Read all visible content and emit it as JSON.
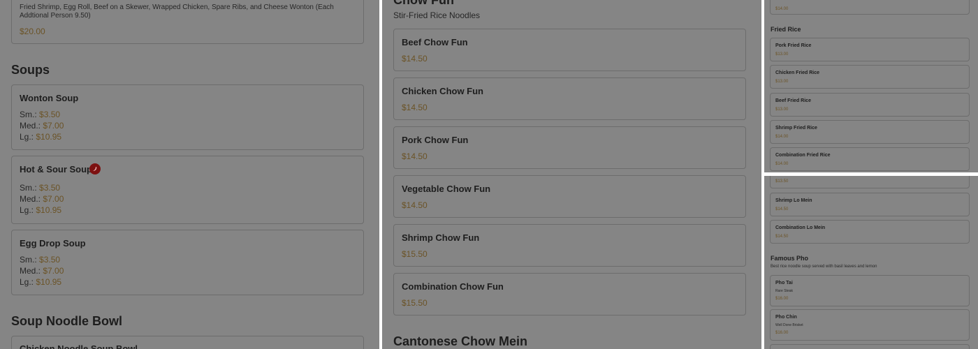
{
  "panel1": {
    "combo_desc": "Fried Shrimp, Egg Roll, Beef on a Skewer, Wrapped Chicken, Spare Ribs, and Cheese Wonton (Each Addtional Person 9.50)",
    "combo_price": "$20.00",
    "soups_title": "Soups",
    "soups": [
      {
        "name": "Wonton Soup",
        "sizes": [
          {
            "label": "Sm.:",
            "price": "$3.50"
          },
          {
            "label": "Med.:",
            "price": "$7.00"
          },
          {
            "label": "Lg.:",
            "price": "$10.95"
          }
        ]
      },
      {
        "name": "Hot & Sour Soup",
        "spicy": true,
        "sizes": [
          {
            "label": "Sm.:",
            "price": "$3.50"
          },
          {
            "label": "Med.:",
            "price": "$7.00"
          },
          {
            "label": "Lg.:",
            "price": "$10.95"
          }
        ]
      },
      {
        "name": "Egg Drop Soup",
        "sizes": [
          {
            "label": "Sm.:",
            "price": "$3.50"
          },
          {
            "label": "Med.:",
            "price": "$7.00"
          },
          {
            "label": "Lg.:",
            "price": "$10.95"
          }
        ]
      }
    ],
    "noodle_title": "Soup Noodle Bowl",
    "noodle_first": "Chicken Noodle Soup Bowl"
  },
  "panel2": {
    "section_title": "Chow Fun",
    "section_sub": "Stir-Fried Rice Noodles",
    "items": [
      {
        "name": "Beef Chow Fun",
        "price": "$14.50"
      },
      {
        "name": "Chicken Chow Fun",
        "price": "$14.50"
      },
      {
        "name": "Pork Chow Fun",
        "price": "$14.50"
      },
      {
        "name": "Vegetable Chow Fun",
        "price": "$14.50"
      },
      {
        "name": "Shrimp Chow Fun",
        "price": "$15.50"
      },
      {
        "name": "Combination Chow Fun",
        "price": "$15.50"
      }
    ],
    "next_section": "Cantonese Chow Mein"
  },
  "panel3": {
    "top_price": "$14.00",
    "section_title": "Fried Rice",
    "items": [
      {
        "name": "Pork Fried Rice",
        "price": "$13.00"
      },
      {
        "name": "Chicken Fried Rice",
        "price": "$13.00"
      },
      {
        "name": "Beef Fried Rice",
        "price": "$13.00"
      },
      {
        "name": "Shrimp Fried Rice",
        "price": "$14.00"
      },
      {
        "name": "Combination Fried Rice",
        "price": "$14.00"
      }
    ]
  },
  "panel4": {
    "top_price": "$13.50",
    "items": [
      {
        "name": "Shrimp Lo Mein",
        "price": "$14.50"
      },
      {
        "name": "Combination Lo Mein",
        "price": "$14.50"
      }
    ],
    "section_title": "Famous Pho",
    "section_sub": "Best rice noodle soup served with basil leaves and lemon",
    "pho": [
      {
        "name": "Pho Tai",
        "sub": "Rare Steak",
        "price": "$16.00"
      },
      {
        "name": "Pho Chin",
        "sub": "Well Done Brisket",
        "price": "$16.00"
      }
    ]
  },
  "colors": {
    "overlay": "#858585",
    "price": "#6b5326",
    "chili": "#7d1111"
  }
}
